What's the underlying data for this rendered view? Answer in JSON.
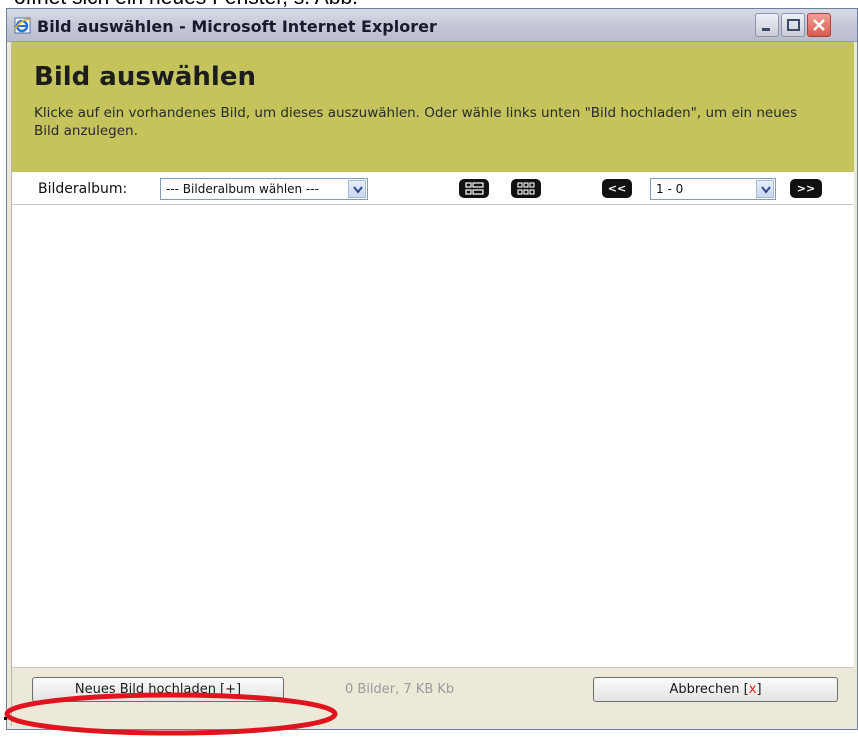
{
  "document_text": "öffnet sich ein neues Fenster, s. Abb.",
  "window": {
    "title": "Bild auswählen - Microsoft Internet Explorer",
    "minimize_icon": "minimize-icon",
    "maximize_icon": "maximize-icon",
    "close_icon": "close-icon"
  },
  "header": {
    "title": "Bild auswählen",
    "description": "Klicke auf ein vorhandenes Bild, um dieses auszuwählen. Oder wähle links unten \"Bild hochladen\", um ein neues Bild anzulegen.",
    "background_color": "#c4c35c"
  },
  "toolbar": {
    "album_label": "Bilderalbum:",
    "album_select_value": "--- Bilderalbum wählen ---",
    "list_view_icon": "list-view-icon",
    "grid_view_icon": "grid-view-icon",
    "prev_label": "<<",
    "page_select_value": "1 - 0",
    "next_label": ">>"
  },
  "footer": {
    "upload_label": "Neues Bild hochladen [+]",
    "count_text": "0 Bilder, 7 KB Kb",
    "cancel_label": "Abbrechen [",
    "cancel_x": "x",
    "cancel_close": "]"
  },
  "annotation": {
    "highlight_color": "#e0141e"
  }
}
